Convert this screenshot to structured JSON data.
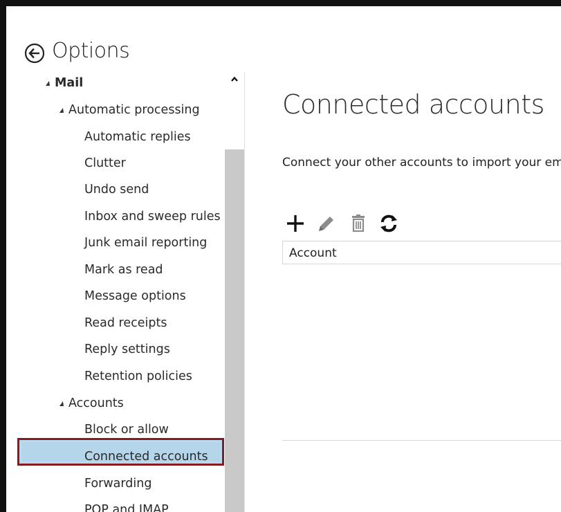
{
  "header": {
    "title": "Options"
  },
  "nav": {
    "items": [
      {
        "label": "Mail",
        "level": 0,
        "expanded": true
      },
      {
        "label": "Automatic processing",
        "level": 1,
        "expanded": true
      },
      {
        "label": "Automatic replies",
        "level": 2
      },
      {
        "label": "Clutter",
        "level": 2
      },
      {
        "label": "Undo send",
        "level": 2
      },
      {
        "label": "Inbox and sweep rules",
        "level": 2
      },
      {
        "label": "Junk email reporting",
        "level": 2
      },
      {
        "label": "Mark as read",
        "level": 2
      },
      {
        "label": "Message options",
        "level": 2
      },
      {
        "label": "Read receipts",
        "level": 2
      },
      {
        "label": "Reply settings",
        "level": 2
      },
      {
        "label": "Retention policies",
        "level": 2
      },
      {
        "label": "Accounts",
        "level": 1,
        "expanded": true
      },
      {
        "label": "Block or allow",
        "level": 2
      },
      {
        "label": "Connected accounts",
        "level": 2,
        "selected": true
      },
      {
        "label": "Forwarding",
        "level": 2
      },
      {
        "label": "POP and IMAP",
        "level": 2
      }
    ]
  },
  "main": {
    "title": "Connected accounts",
    "description": "Connect your other accounts to import your em",
    "toolbar": {
      "add_icon": "plus-icon",
      "edit_icon": "pencil-icon",
      "delete_icon": "trash-icon",
      "refresh_icon": "refresh-icon"
    },
    "table": {
      "columns": [
        "Account"
      ]
    }
  },
  "colors": {
    "selection_bg": "#b5d6ea",
    "selection_border": "#8b1a1f",
    "scrollbar": "#c9c9c9"
  }
}
